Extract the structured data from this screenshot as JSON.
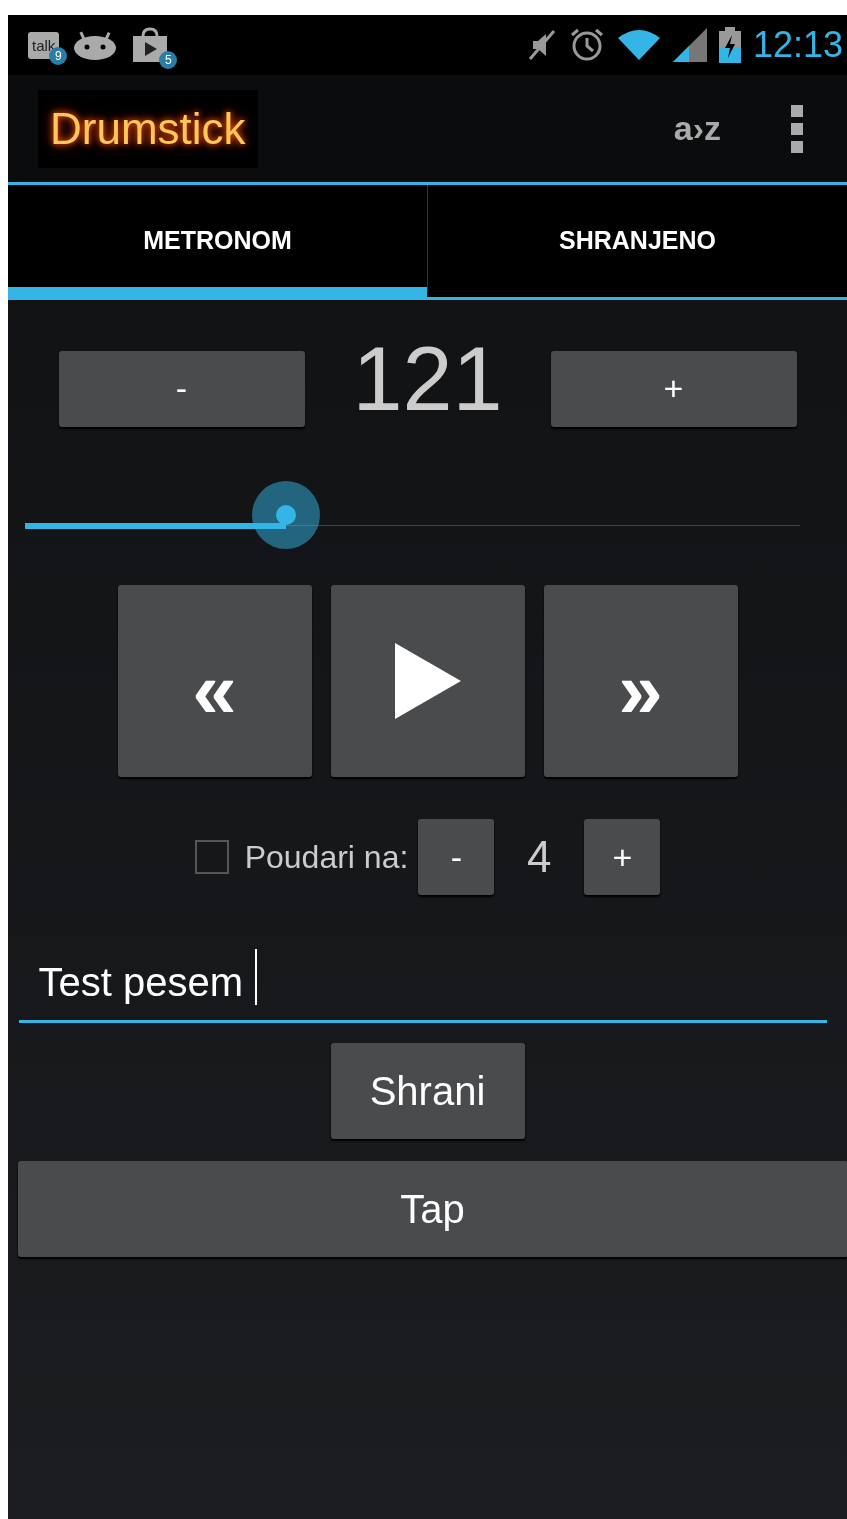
{
  "status_bar": {
    "notifications": [
      {
        "kind": "talk",
        "label": "talk",
        "badge": "9"
      },
      {
        "kind": "android"
      },
      {
        "kind": "store",
        "badge": "5"
      }
    ],
    "time": "12:13"
  },
  "action_bar": {
    "title": "Drumstick",
    "sort_label": "a›z"
  },
  "tabs": [
    {
      "label": "METRONOM",
      "selected": true
    },
    {
      "label": "SHRANJENO",
      "selected": false
    }
  ],
  "tempo": {
    "minus": "-",
    "value": "121",
    "plus": "+"
  },
  "tempo_slider": {
    "level": 0.337
  },
  "transport": [
    {
      "kind": "rewind",
      "label": "«"
    },
    {
      "kind": "play"
    },
    {
      "kind": "forward",
      "label": "»"
    }
  ],
  "accent": {
    "checked": false,
    "label": "Poudari na:",
    "minus": "-",
    "value": "4",
    "plus": "+"
  },
  "song_name": {
    "value": "Test pesem"
  },
  "save_button": "Shrani",
  "tap_button": "Tap"
}
